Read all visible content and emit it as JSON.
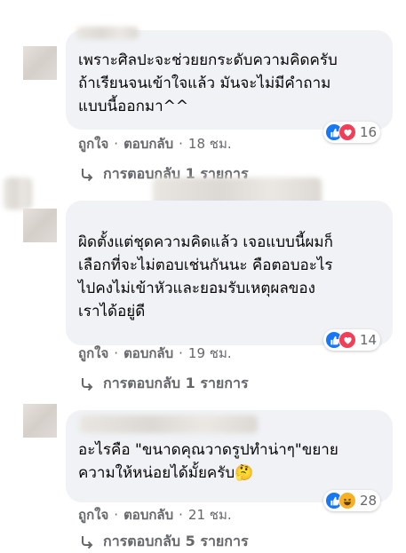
{
  "comments": [
    {
      "text": "เพราะศิลปะจะช่วยยกระดับความคิดครับ\nถ้าเรียนจนเข้าใจแล้ว มันจะไม่มีคำถาม\nแบบนี้ออกมา^^",
      "reactions": [
        "like",
        "love"
      ],
      "reaction_count": "16",
      "like_label": "ถูกใจ",
      "reply_label": "ตอบกลับ",
      "time": "18 ชม.",
      "replies_text": "การตอบกลับ 1 รายการ"
    },
    {
      "text": "ผิดตั้งแต่ชุดความคิดแล้ว เจอแบบนี้ผมก็\nเลือกที่จะไม่ตอบเช่นกันนะ คือตอบอะไร\nไปคงไม่เข้าหัวและยอมรับเหตุผลของ\nเราได้อยู่ดี",
      "reactions": [
        "like",
        "love"
      ],
      "reaction_count": "14",
      "like_label": "ถูกใจ",
      "reply_label": "ตอบกลับ",
      "time": "19 ชม.",
      "replies_text": "การตอบกลับ 1 รายการ"
    },
    {
      "text": "อะไรคือ \"ขนาดคุณวาดรูปทำน่าๆ\"ขยาย\nความให้หน่อยได้มั้ยครับ",
      "emoji": "🤔",
      "reactions": [
        "like",
        "haha"
      ],
      "reaction_count": "28",
      "like_label": "ถูกใจ",
      "reply_label": "ตอบกลับ",
      "time": "21 ชม.",
      "replies_text": "การตอบกลับ 5 รายการ"
    }
  ],
  "separator": "·",
  "colors": {
    "like": "#1877f2",
    "love": "#f33e58",
    "haha": "#f7b125",
    "bubble": "#f0f2f5",
    "meta": "#65676b"
  }
}
